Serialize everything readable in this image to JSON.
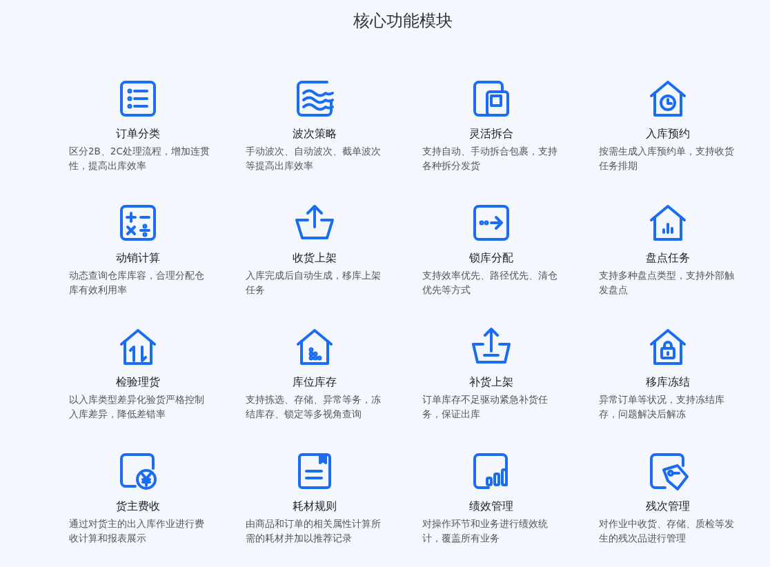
{
  "section_title": "核心功能模块",
  "features": [
    {
      "title": "订单分类",
      "description": "区分2B、2C处理流程，增加连贯性，提高出库效率"
    },
    {
      "title": "波次策略",
      "description": "手动波次、自动波次、截单波次等提高出库效率"
    },
    {
      "title": "灵活拆合",
      "description": "支持自动、手动拆合包裹，支持各种拆分发货"
    },
    {
      "title": "入库预约",
      "description": "按需生成入库预约单，支持收货任务排期"
    },
    {
      "title": "动销计算",
      "description": "动态查询仓库库容，合理分配仓库有效利用率"
    },
    {
      "title": "收货上架",
      "description": "入库完成后自动生成，移库上架任务"
    },
    {
      "title": "锁库分配",
      "description": "支持效率优先、路径优先、清仓优先等方式"
    },
    {
      "title": "盘点任务",
      "description": "支持多种盘点类型，支持外部触发盘点"
    },
    {
      "title": "检验理货",
      "description": "以入库类型差异化验货严格控制入库差异，降低差错率"
    },
    {
      "title": "库位库存",
      "description": "支持拣选、存储、异常等务，冻结库存、锁定等多视角查询"
    },
    {
      "title": "补货上架",
      "description": "订单库存不足驱动紧急补货任务，保证出库"
    },
    {
      "title": "移库冻结",
      "description": "异常订单等状况，支持冻结库存，问题解决后解冻"
    },
    {
      "title": "货主费收",
      "description": "通过对货主的出入库作业进行费收计算和报表展示"
    },
    {
      "title": "耗材规则",
      "description": "由商品和订单的相关属性计算所需的耗材并加以推荐记录"
    },
    {
      "title": "绩效管理",
      "description": "对操作环节和业务进行绩效统计，覆盖所有业务"
    },
    {
      "title": "残次管理",
      "description": "对作业中收货、存储、质检等发生的残次品进行管理"
    }
  ]
}
